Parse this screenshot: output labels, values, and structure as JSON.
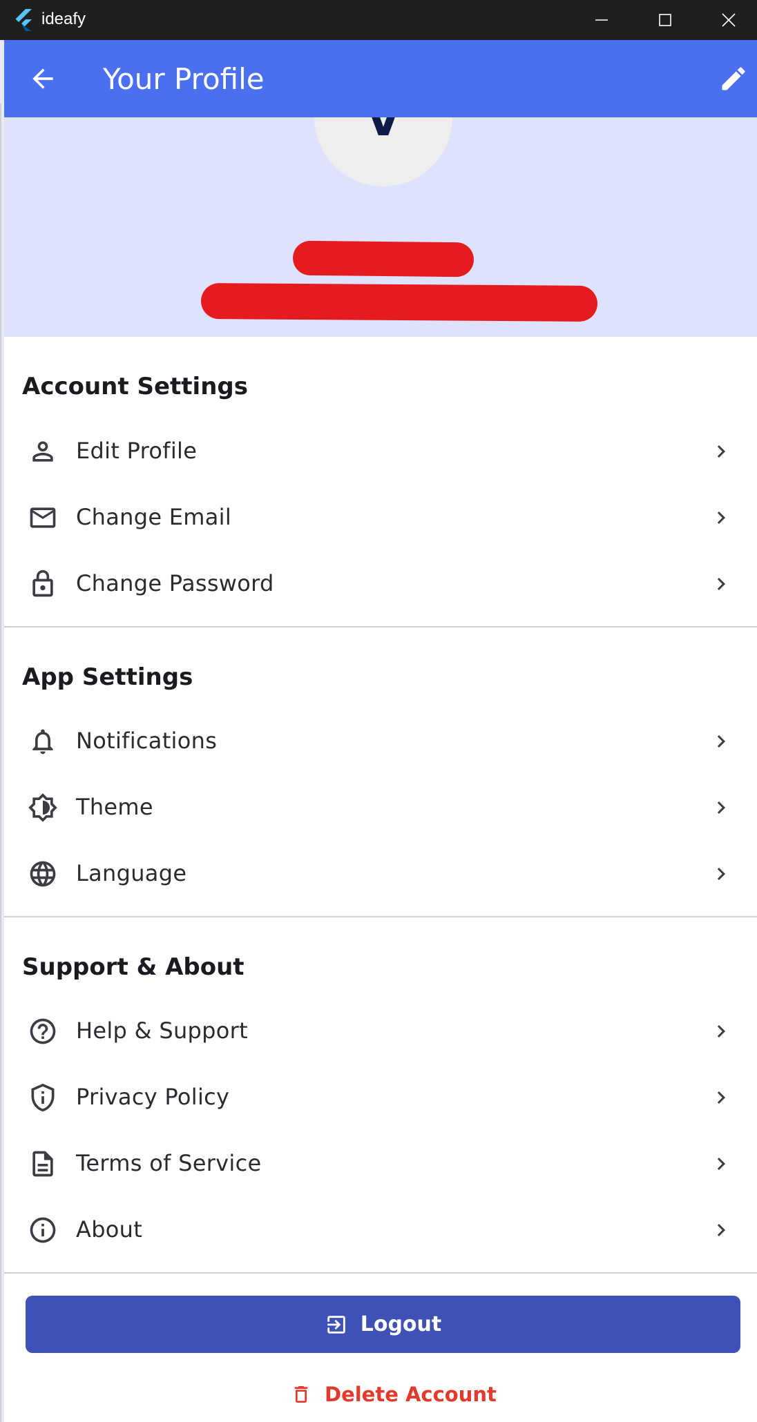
{
  "window": {
    "app_name": "ideafy"
  },
  "appbar": {
    "title": "Your Profile"
  },
  "profile": {
    "avatar_initial": "V"
  },
  "sections": [
    {
      "title": "Account Settings",
      "items": [
        {
          "label": "Edit Profile",
          "icon": "person-icon"
        },
        {
          "label": "Change Email",
          "icon": "mail-icon"
        },
        {
          "label": "Change Password",
          "icon": "lock-icon"
        }
      ]
    },
    {
      "title": "App Settings",
      "items": [
        {
          "label": "Notifications",
          "icon": "bell-icon"
        },
        {
          "label": "Theme",
          "icon": "brightness-icon"
        },
        {
          "label": "Language",
          "icon": "globe-icon"
        }
      ]
    },
    {
      "title": "Support & About",
      "items": [
        {
          "label": "Help & Support",
          "icon": "help-icon"
        },
        {
          "label": "Privacy Policy",
          "icon": "shield-icon"
        },
        {
          "label": "Terms of Service",
          "icon": "document-icon"
        },
        {
          "label": "About",
          "icon": "info-icon"
        }
      ]
    }
  ],
  "actions": {
    "logout_label": "Logout",
    "delete_label": "Delete Account"
  },
  "colors": {
    "appbar": "#4a70ef",
    "header_bg": "#dfe2fd",
    "logout_button": "#3f51b5",
    "delete_text": "#e5392b",
    "redaction": "#e51c1f"
  }
}
